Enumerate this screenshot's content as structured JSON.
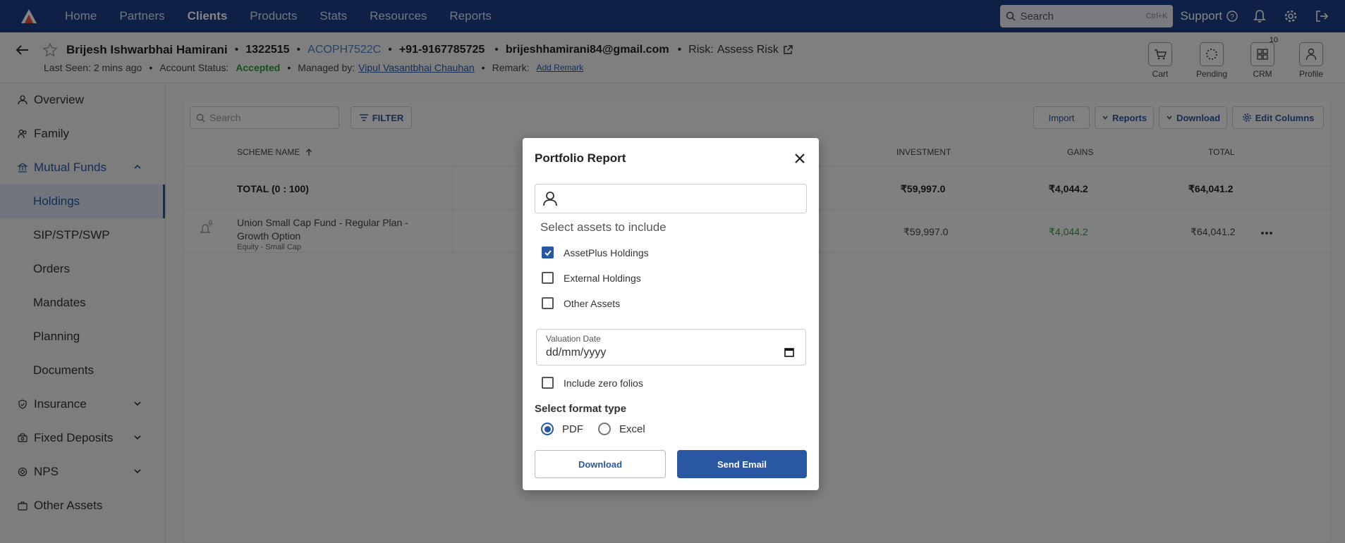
{
  "nav": {
    "links": [
      "Home",
      "Partners",
      "Clients",
      "Products",
      "Stats",
      "Resources",
      "Reports"
    ],
    "active": "Clients",
    "search_placeholder": "Search",
    "search_shortcut": "Ctrl+K",
    "support_label": "Support"
  },
  "client": {
    "name": "Brijesh Ishwarbhai Hamirani",
    "id": "1322515",
    "pan": "ACOPH7522C",
    "phone": "+91-9167785725",
    "email": "brijeshhamirani84@gmail.com",
    "risk_label": "Risk:",
    "risk_value": "Assess Risk",
    "last_seen": "Last Seen: 2 mins ago",
    "account_status_label": "Account Status:",
    "account_status_value": "Accepted",
    "managed_by_label": "Managed by:",
    "managed_by_value": "Vipul Vasantbhai Chauhan",
    "remark_label": "Remark:",
    "remark_action": "Add Remark"
  },
  "quick_actions": [
    {
      "label": "Cart",
      "icon": "cart-icon"
    },
    {
      "label": "Pending",
      "icon": "pending-icon"
    },
    {
      "label": "CRM",
      "icon": "grid-icon",
      "badge": "10"
    },
    {
      "label": "Profile",
      "icon": "profile-icon"
    }
  ],
  "sidebar": {
    "items": [
      {
        "label": "Overview",
        "icon": "user-icon"
      },
      {
        "label": "Family",
        "icon": "family-icon"
      },
      {
        "label": "Mutual Funds",
        "icon": "bank-icon",
        "expanded": true
      },
      {
        "label": "Holdings",
        "active": true
      },
      {
        "label": "SIP/STP/SWP"
      },
      {
        "label": "Orders"
      },
      {
        "label": "Mandates"
      },
      {
        "label": "Planning"
      },
      {
        "label": "Documents"
      },
      {
        "label": "Insurance",
        "icon": "shield-icon"
      },
      {
        "label": "Fixed Deposits",
        "icon": "deposit-icon"
      },
      {
        "label": "NPS",
        "icon": "nps-icon"
      },
      {
        "label": "Other Assets",
        "icon": "briefcase-icon"
      }
    ]
  },
  "toolbar": {
    "search_placeholder": "Search",
    "filter_label": "FILTER",
    "import_label": "Import",
    "reports_label": "Reports",
    "download_label": "Download",
    "edit_columns_label": "Edit Columns"
  },
  "table": {
    "headers": {
      "scheme_name": "SCHEME NAME",
      "investment": "INVESTMENT",
      "gains": "GAINS",
      "total": "TOTAL"
    },
    "total_row": {
      "label": "TOTAL (0 : 100)",
      "investment": "₹59,997.0",
      "gains": "₹4,044.2",
      "total": "₹64,041.2"
    },
    "rows": [
      {
        "scheme_line1": "Union Small Cap Fund - Regular Plan -",
        "scheme_line2": "Growth Option",
        "category": "Equity - Small Cap",
        "bell_count": "0",
        "investment": "₹59,997.0",
        "gains": "₹4,044.2",
        "total": "₹64,041.2"
      }
    ]
  },
  "modal": {
    "title": "Portfolio Report",
    "assets_label": "Select assets to include",
    "assets": [
      {
        "label": "AssetPlus Holdings",
        "checked": true
      },
      {
        "label": "External Holdings",
        "checked": false
      },
      {
        "label": "Other Assets",
        "checked": false
      }
    ],
    "valuation_date_label": "Valuation Date",
    "valuation_date_value": "dd/mm/yyyy",
    "zero_folios_label": "Include zero folios",
    "format_label": "Select format type",
    "formats": [
      {
        "label": "PDF",
        "selected": true
      },
      {
        "label": "Excel",
        "selected": false
      }
    ],
    "download_label": "Download",
    "send_email_label": "Send Email"
  },
  "colors": {
    "nav_bg": "#1c3f84",
    "accent": "#2957a4",
    "success": "#2e9a3a",
    "gains_green": "#2e9a3a"
  }
}
